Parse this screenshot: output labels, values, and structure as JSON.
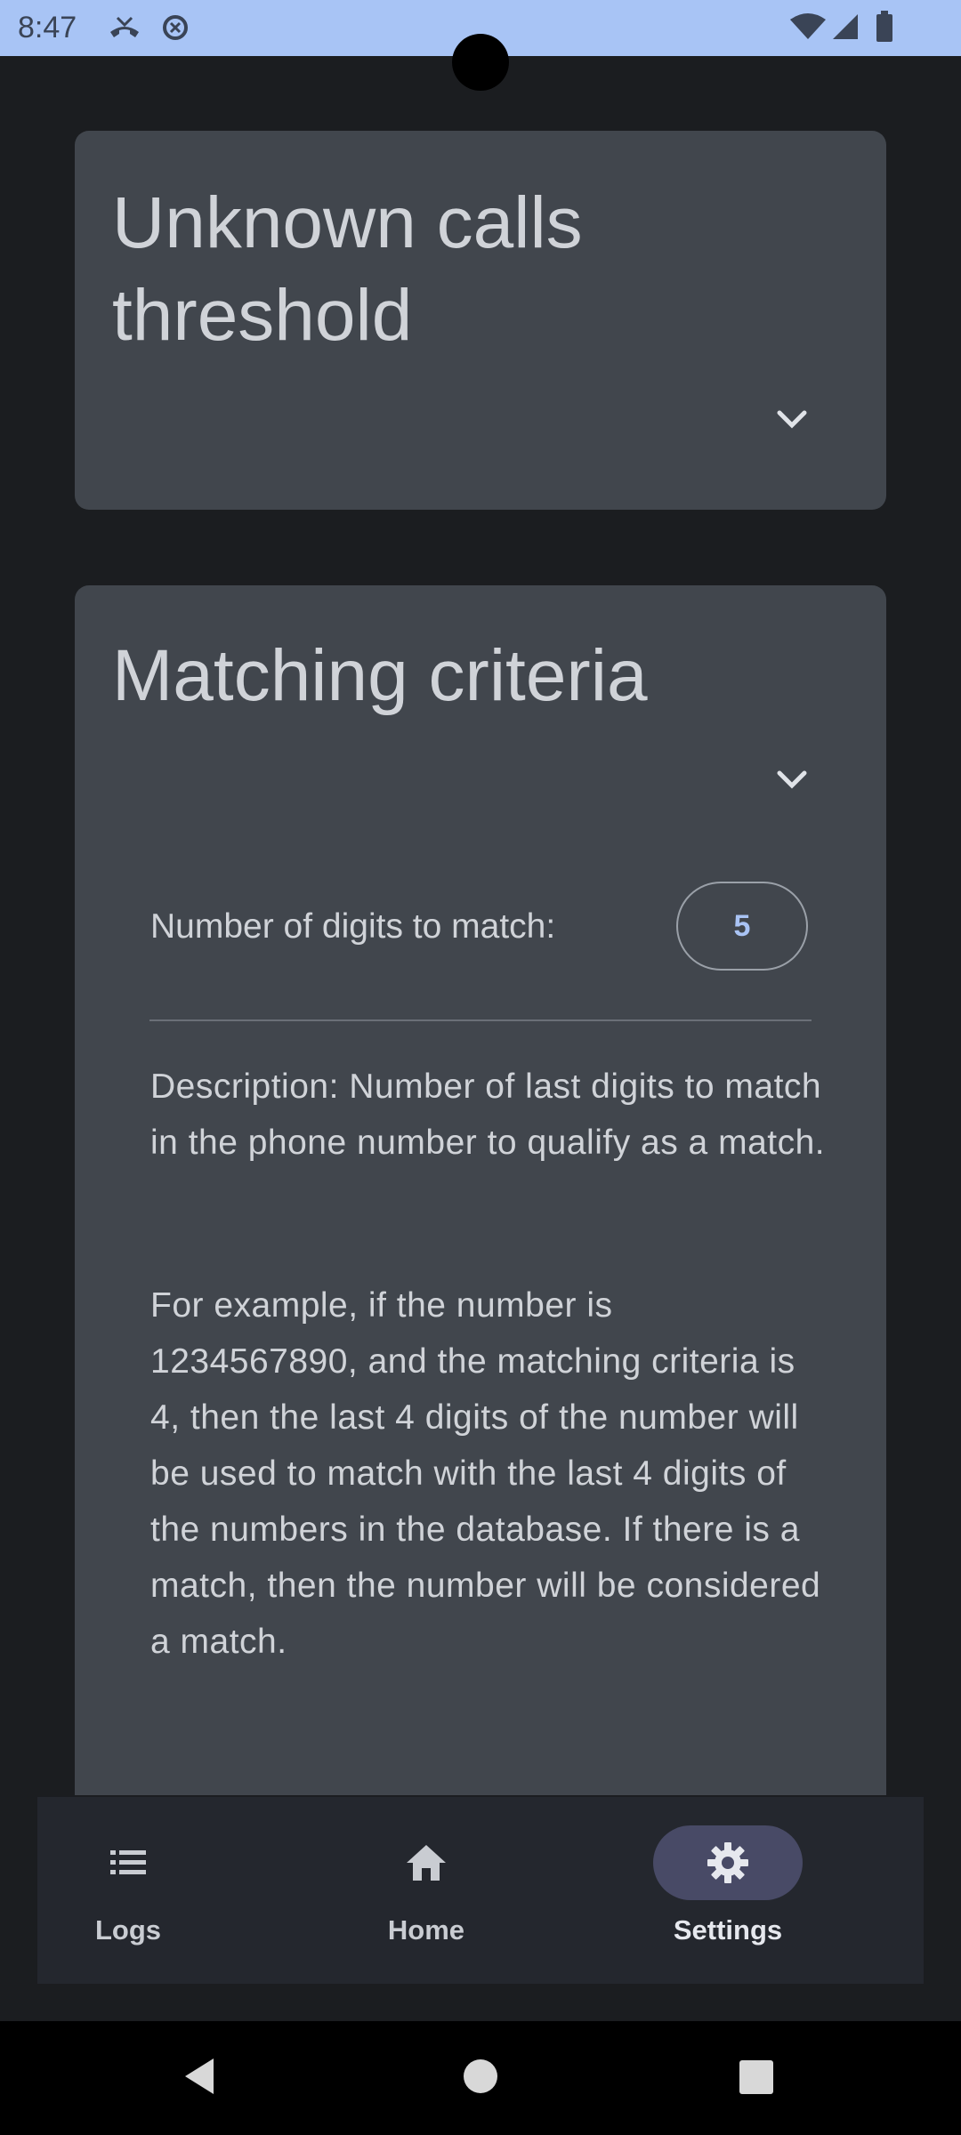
{
  "status_bar": {
    "time": "8:47"
  },
  "cards": {
    "threshold": {
      "title": "Unknown calls threshold"
    },
    "matching": {
      "title": "Matching criteria",
      "digits_label": "Number of digits to match:",
      "digits_value": "5",
      "description": "Description: Number of last digits to match in the phone number to qualify as a match.",
      "example": "For example, if the number is 1234567890, and the matching criteria is 4, then the last 4 digits of the number will be used to match with the last 4 digits of the numbers in the database. If there is a match, then the number will be considered a match."
    }
  },
  "bottom_nav": {
    "items": [
      {
        "label": "Logs",
        "icon": "list-icon"
      },
      {
        "label": "Home",
        "icon": "home-icon"
      },
      {
        "label": "Settings",
        "icon": "gear-icon",
        "selected": true
      }
    ]
  },
  "colors": {
    "status_bar": "#a8c4f5",
    "background": "#1b1d20",
    "card": "#41464d",
    "accent": "#a9c3f4",
    "nav_selected_pill": "#484a66"
  }
}
